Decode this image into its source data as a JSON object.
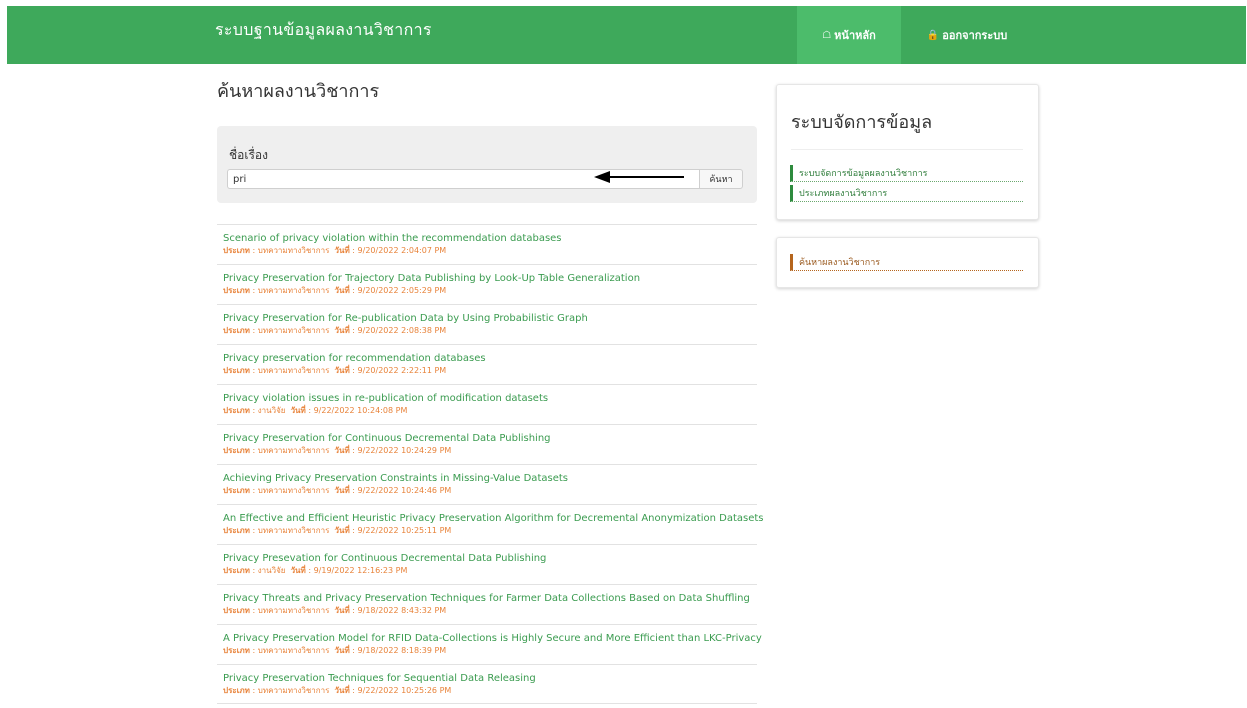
{
  "header": {
    "brand": "ระบบฐานข้อมูลผลงานวิชาการ",
    "nav": [
      {
        "label": "หน้าหลัก",
        "icon": "home-icon"
      },
      {
        "label": "ออกจากระบบ",
        "icon": "lock-icon"
      }
    ]
  },
  "main": {
    "title": "ค้นหาผลงานวิชาการ",
    "search": {
      "label": "ชื่อเรื่อง",
      "value": "pri",
      "button": "ค้นหา"
    },
    "meta_labels": {
      "type": "ประเภท",
      "date": "วันที่"
    },
    "results": [
      {
        "title": "Scenario of privacy violation within the recommendation databases",
        "type": "บทความทางวิชาการ",
        "date": "9/20/2022 2:04:07 PM"
      },
      {
        "title": "Privacy Preservation for Trajectory Data Publishing by Look-Up Table Generalization",
        "type": "บทความทางวิชาการ",
        "date": "9/20/2022 2:05:29 PM"
      },
      {
        "title": "Privacy Preservation for Re-publication Data by Using Probabilistic Graph",
        "type": "บทความทางวิชาการ",
        "date": "9/20/2022 2:08:38 PM"
      },
      {
        "title": "Privacy preservation for recommendation databases",
        "type": "บทความทางวิชาการ",
        "date": "9/20/2022 2:22:11 PM"
      },
      {
        "title": "Privacy violation issues in re-publication of modification datasets",
        "type": "งานวิจัย",
        "date": "9/22/2022 10:24:08 PM"
      },
      {
        "title": "Privacy Preservation for Continuous Decremental Data Publishing",
        "type": "บทความทางวิชาการ",
        "date": "9/22/2022 10:24:29 PM"
      },
      {
        "title": "Achieving Privacy Preservation Constraints in Missing-Value Datasets",
        "type": "บทความทางวิชาการ",
        "date": "9/22/2022 10:24:46 PM"
      },
      {
        "title": "An Effective and Efficient Heuristic Privacy Preservation Algorithm for Decremental Anonymization Datasets",
        "type": "บทความทางวิชาการ",
        "date": "9/22/2022 10:25:11 PM"
      },
      {
        "title": "Privacy Presevation for Continuous Decremental Data Publishing",
        "type": "งานวิจัย",
        "date": "9/19/2022 12:16:23 PM"
      },
      {
        "title": "Privacy Threats and Privacy Preservation Techniques for Farmer Data Collections Based on Data Shuffling",
        "type": "บทความทางวิชาการ",
        "date": "9/18/2022 8:43:32 PM"
      },
      {
        "title": "A Privacy Preservation Model for RFID Data-Collections is Highly Secure and More Efficient than LKC-Privacy",
        "type": "บทความทางวิชาการ",
        "date": "9/18/2022 8:18:39 PM"
      },
      {
        "title": "Privacy Preservation Techniques for Sequential Data Releasing",
        "type": "บทความทางวิชาการ",
        "date": "9/22/2022 10:25:26 PM"
      }
    ]
  },
  "sidebar": {
    "panel_title": "ระบบจัดการข้อมูล",
    "links": [
      "ระบบจัดการข้อมูลผลงานวิชาการ",
      "ประเภทผลงานวิชาการ"
    ],
    "search_link": "ค้นหาผลงานวิชาการ"
  },
  "colors": {
    "header": "#3ea95b",
    "link": "#3a9b4f",
    "meta": "#e8833a"
  }
}
